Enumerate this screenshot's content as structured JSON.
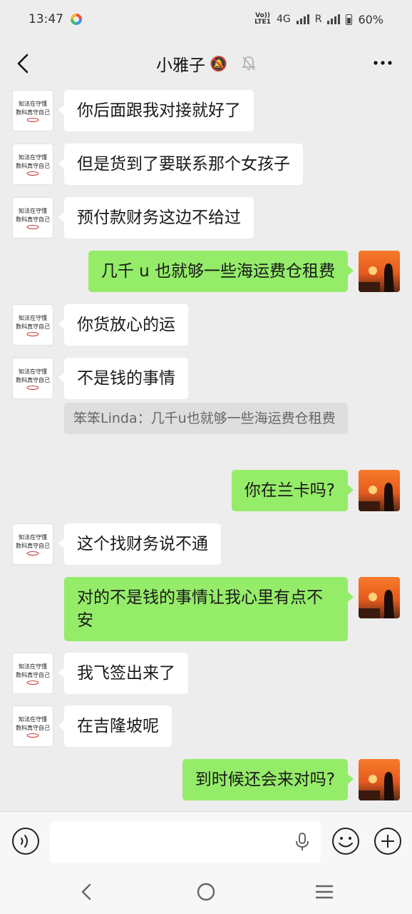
{
  "status_bar": {
    "time": "13:47",
    "network": "4G",
    "roaming": "R",
    "volte_top": "Vo))",
    "volte_bottom": "LTE1",
    "battery": "60%"
  },
  "header": {
    "title": "小雅子",
    "title_emoji": "🔕"
  },
  "messages": [
    {
      "side": "in",
      "text": "你后面跟我对接就好了"
    },
    {
      "side": "in",
      "text": "但是货到了要联系那个女孩子"
    },
    {
      "side": "in",
      "text": "预付款财务这边不给过"
    },
    {
      "side": "out",
      "text": "几千 u 也就够一些海运费仓租费"
    },
    {
      "side": "in",
      "text": "你货放心的运"
    },
    {
      "side": "in",
      "text": "不是钱的事情"
    },
    {
      "side": "quote",
      "text": "笨笨Linda：几千u也就够一些海运费仓租费"
    },
    {
      "side": "out",
      "text": "你在兰卡吗?"
    },
    {
      "side": "in",
      "text": "这个找财务说不通"
    },
    {
      "side": "out",
      "text": "对的不是钱的事情让我心里有点不安"
    },
    {
      "side": "in",
      "text": "我飞签出来了"
    },
    {
      "side": "in",
      "text": "在吉隆坡呢"
    },
    {
      "side": "out",
      "text": "到时候还会来对吗?"
    }
  ],
  "contact_avatar_text": [
    "知法在守懂",
    "数科真守自己"
  ],
  "colors": {
    "background": "#ededed",
    "incoming_bubble": "#ffffff",
    "outgoing_bubble": "#95ec69",
    "quote_bg": "#dedede"
  },
  "icons": {
    "back": "chevron-left-icon",
    "mute": "bell-off-icon",
    "more": "more-dots-icon",
    "voice": "voice-icon",
    "mic": "microphone-icon",
    "emoji": "emoji-icon",
    "plus": "plus-icon"
  }
}
